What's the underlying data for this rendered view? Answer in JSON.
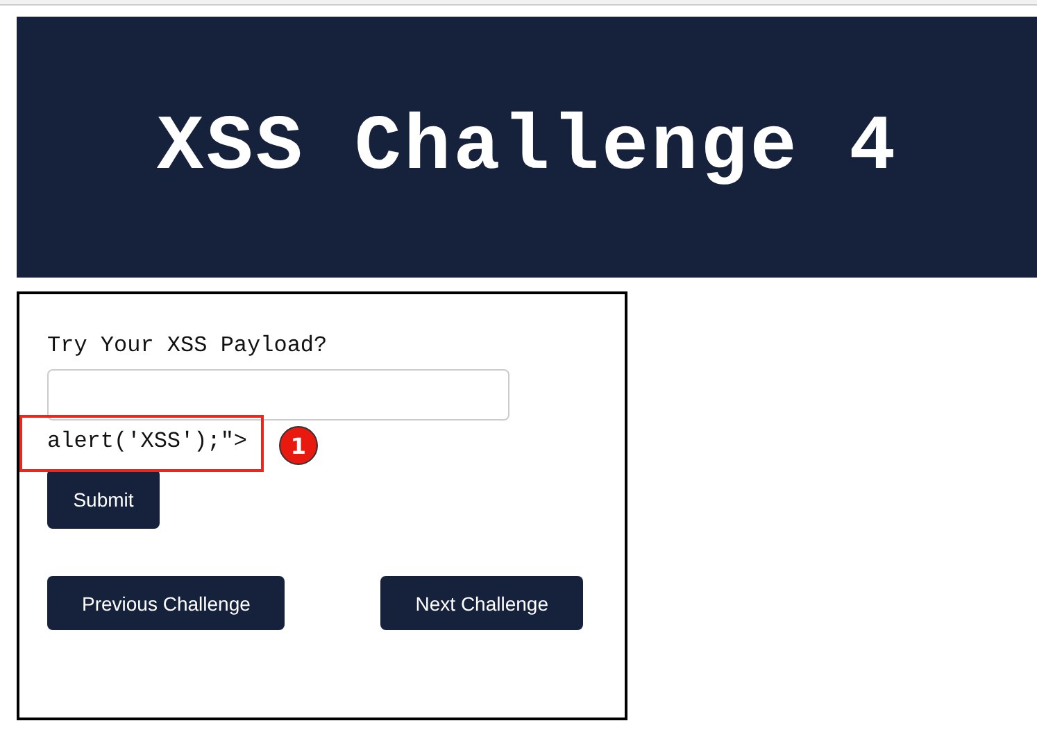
{
  "header": {
    "title": "XSS Challenge 4"
  },
  "form": {
    "label": "Try Your XSS Payload?",
    "reflected_output": "alert('XSS');\">",
    "submit": "Submit"
  },
  "annotation": {
    "marker": "1"
  },
  "navigation": [
    "Previous Challenge",
    "Next Challenge"
  ]
}
